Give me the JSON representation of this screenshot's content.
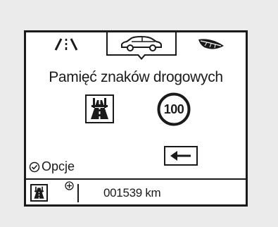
{
  "tabs": [
    {
      "icon": "road-lanes-icon"
    },
    {
      "icon": "car-icon",
      "selected": true
    },
    {
      "icon": "eco-leaf-icon"
    }
  ],
  "title": "Pamięć znaków drogowych",
  "signs": {
    "motorway": {
      "icon": "motorway-sign-icon"
    },
    "speed_limit": {
      "value": "100"
    }
  },
  "options_label": "Opcje",
  "back": {
    "icon": "back-arrow-icon"
  },
  "status": {
    "sign_icon": "motorway-sign-icon",
    "plus_icon": "plus-circle-icon",
    "odometer": "001539 km"
  }
}
